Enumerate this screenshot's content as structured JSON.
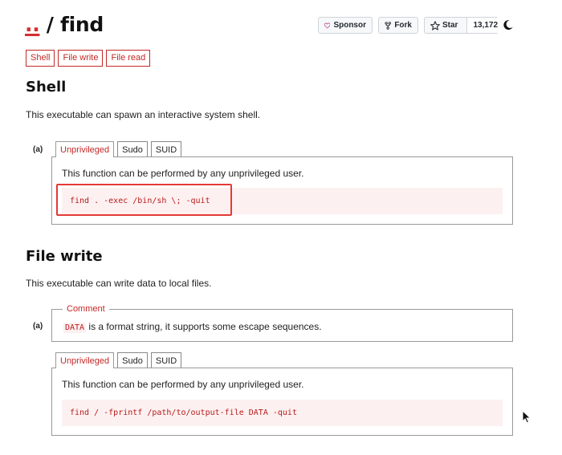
{
  "header": {
    "title_dots": "..",
    "title_rest": " / find",
    "sponsor_label": "Sponsor",
    "fork_label": "Fork",
    "star_label": "Star",
    "star_count": "13,172"
  },
  "tags": [
    "Shell",
    "File write",
    "File read"
  ],
  "shell": {
    "heading": "Shell",
    "description": "This executable can spawn an interactive system shell.",
    "label": "(a)",
    "tabs": [
      "Unprivileged",
      "Sudo",
      "SUID"
    ],
    "panel_text": "This function can be performed by any unprivileged user.",
    "code": "find . -exec /bin/sh \\; -quit"
  },
  "file_write": {
    "heading": "File write",
    "description": "This executable can write data to local files.",
    "label": "(a)",
    "comment_legend": "Comment",
    "comment_code": "DATA",
    "comment_text": " is a format string, it supports some escape sequences.",
    "tabs": [
      "Unprivileged",
      "Sudo",
      "SUID"
    ],
    "panel_text": "This function can be performed by any unprivileged user.",
    "code": "find / -fprintf /path/to/output-file DATA -quit"
  },
  "colors": {
    "accent": "#c62828",
    "code_bg": "#fdf0f0",
    "highlight": "#e53935"
  }
}
